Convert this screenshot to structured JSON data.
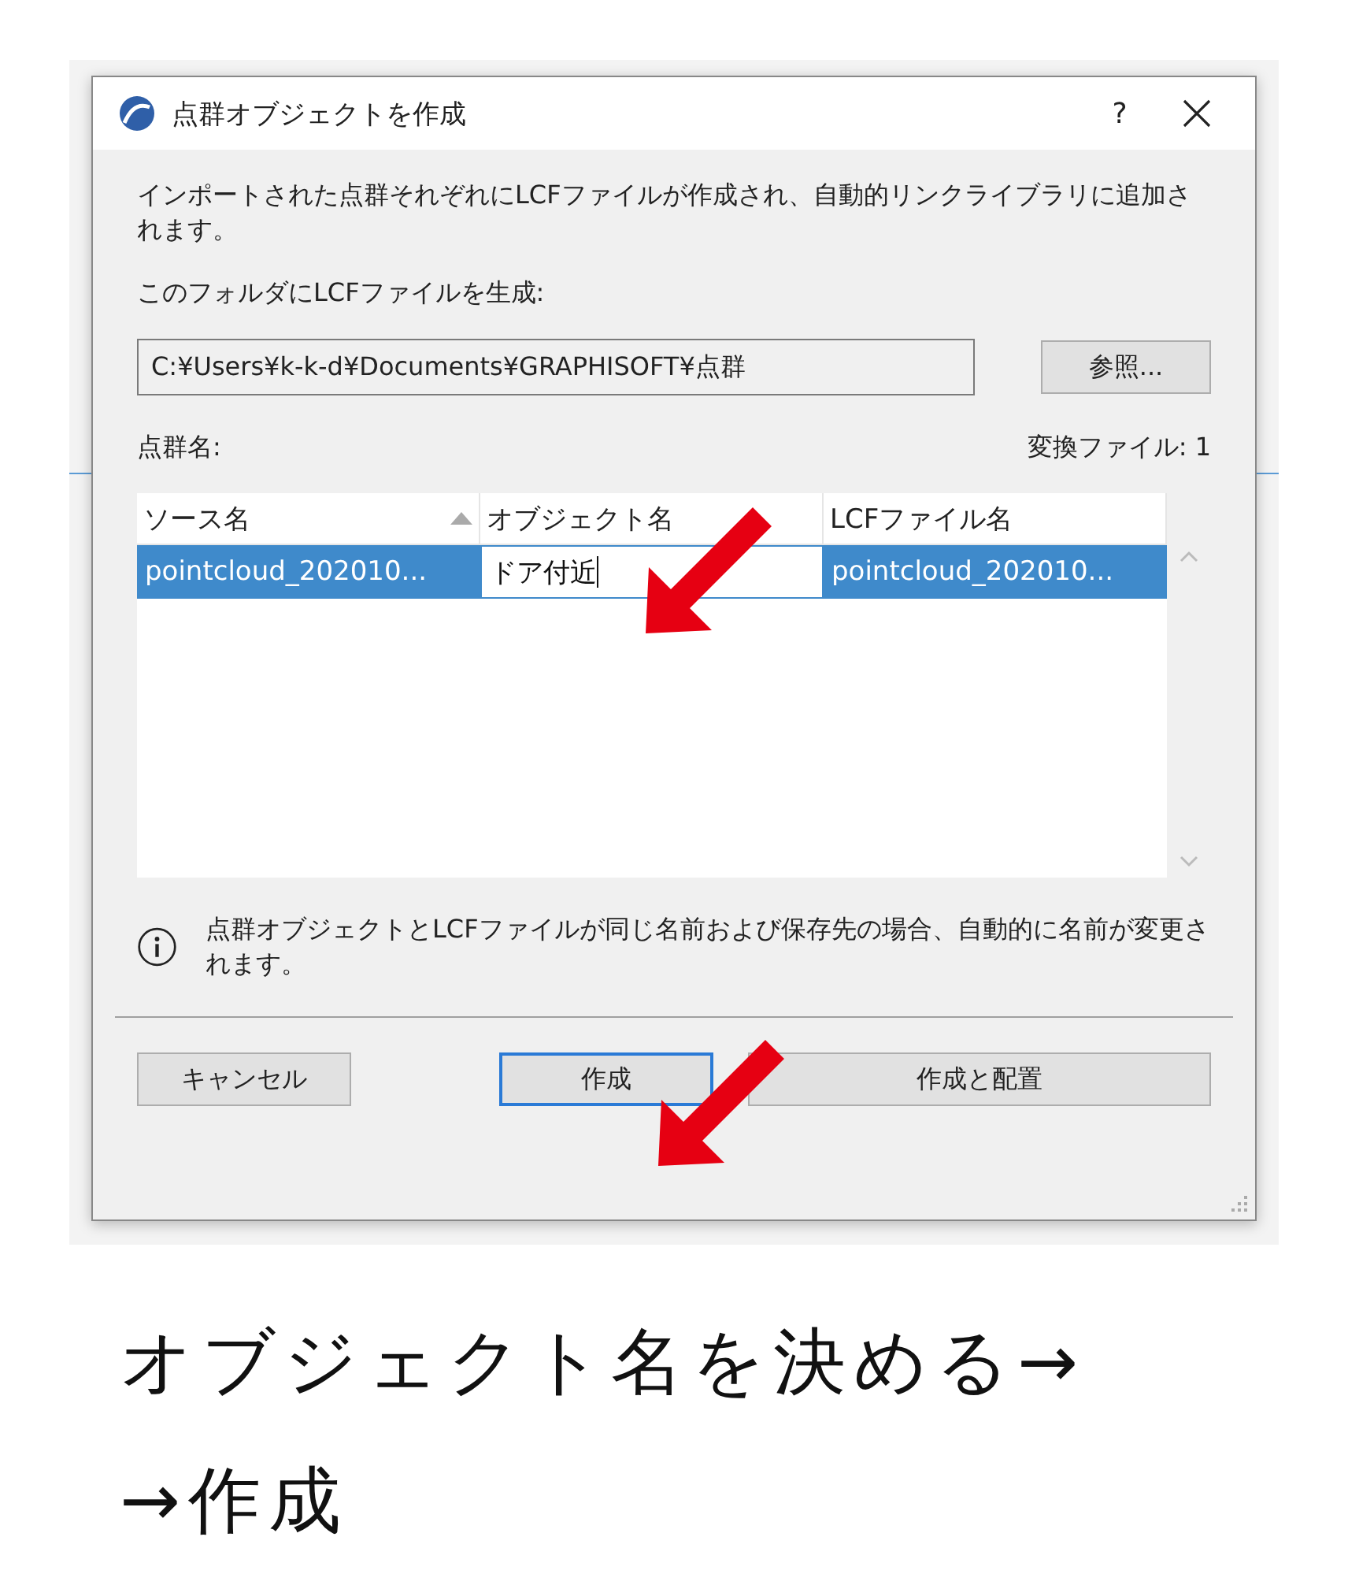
{
  "dialog": {
    "title": "点群オブジェクトを作成",
    "help": "?",
    "description": "インポートされた点群それぞれにLCFファイルが作成され、自動的リンクライブラリに追加されます。",
    "folder_label": "このフォルダにLCFファイルを生成:",
    "folder_path": "C:¥Users¥k-k-d¥Documents¥GRAPHISOFT¥点群",
    "browse_button": "参照...",
    "list_label": "点群名:",
    "converted_count": "変換ファイル: 1",
    "table": {
      "columns": [
        {
          "label": "ソース名",
          "sorted": true
        },
        {
          "label": "オブジェクト名",
          "sorted": false
        },
        {
          "label": "LCFファイル名",
          "sorted": false
        }
      ],
      "rows": [
        {
          "selected": true,
          "cells": [
            {
              "text": "pointcloud_202010...",
              "editing": false
            },
            {
              "text": "ドア付近",
              "editing": true
            },
            {
              "text": "pointcloud_202010...",
              "editing": false
            }
          ]
        }
      ]
    },
    "note": "点群オブジェクトとLCFファイルが同じ名前および保存先の場合、自動的に名前が変更されます。",
    "buttons": [
      {
        "label": "キャンセル",
        "default": false,
        "kind": "small"
      },
      {
        "label": "作成",
        "default": true,
        "kind": "small"
      },
      {
        "label": "作成と配置",
        "default": false,
        "kind": "wide"
      }
    ]
  },
  "caption": [
    "オブジェクト名を決める→",
    "→作成"
  ]
}
